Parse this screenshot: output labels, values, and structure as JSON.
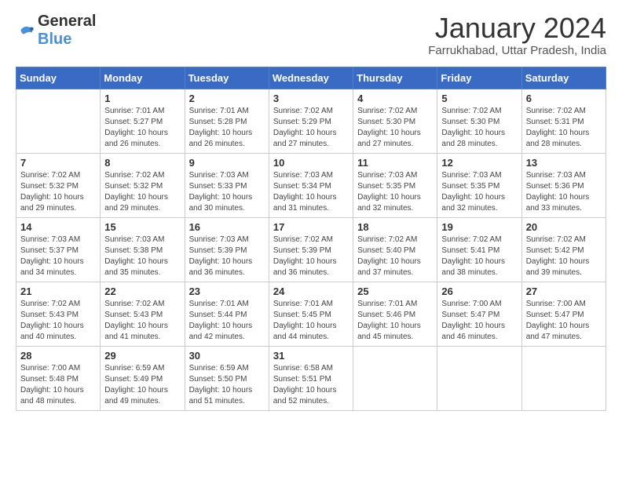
{
  "header": {
    "logo_line1": "General",
    "logo_line2": "Blue",
    "month": "January 2024",
    "location": "Farrukhabad, Uttar Pradesh, India"
  },
  "days_of_week": [
    "Sunday",
    "Monday",
    "Tuesday",
    "Wednesday",
    "Thursday",
    "Friday",
    "Saturday"
  ],
  "weeks": [
    [
      {
        "num": "",
        "info": ""
      },
      {
        "num": "1",
        "info": "Sunrise: 7:01 AM\nSunset: 5:27 PM\nDaylight: 10 hours\nand 26 minutes."
      },
      {
        "num": "2",
        "info": "Sunrise: 7:01 AM\nSunset: 5:28 PM\nDaylight: 10 hours\nand 26 minutes."
      },
      {
        "num": "3",
        "info": "Sunrise: 7:02 AM\nSunset: 5:29 PM\nDaylight: 10 hours\nand 27 minutes."
      },
      {
        "num": "4",
        "info": "Sunrise: 7:02 AM\nSunset: 5:30 PM\nDaylight: 10 hours\nand 27 minutes."
      },
      {
        "num": "5",
        "info": "Sunrise: 7:02 AM\nSunset: 5:30 PM\nDaylight: 10 hours\nand 28 minutes."
      },
      {
        "num": "6",
        "info": "Sunrise: 7:02 AM\nSunset: 5:31 PM\nDaylight: 10 hours\nand 28 minutes."
      }
    ],
    [
      {
        "num": "7",
        "info": "Sunrise: 7:02 AM\nSunset: 5:32 PM\nDaylight: 10 hours\nand 29 minutes."
      },
      {
        "num": "8",
        "info": "Sunrise: 7:02 AM\nSunset: 5:32 PM\nDaylight: 10 hours\nand 29 minutes."
      },
      {
        "num": "9",
        "info": "Sunrise: 7:03 AM\nSunset: 5:33 PM\nDaylight: 10 hours\nand 30 minutes."
      },
      {
        "num": "10",
        "info": "Sunrise: 7:03 AM\nSunset: 5:34 PM\nDaylight: 10 hours\nand 31 minutes."
      },
      {
        "num": "11",
        "info": "Sunrise: 7:03 AM\nSunset: 5:35 PM\nDaylight: 10 hours\nand 32 minutes."
      },
      {
        "num": "12",
        "info": "Sunrise: 7:03 AM\nSunset: 5:35 PM\nDaylight: 10 hours\nand 32 minutes."
      },
      {
        "num": "13",
        "info": "Sunrise: 7:03 AM\nSunset: 5:36 PM\nDaylight: 10 hours\nand 33 minutes."
      }
    ],
    [
      {
        "num": "14",
        "info": "Sunrise: 7:03 AM\nSunset: 5:37 PM\nDaylight: 10 hours\nand 34 minutes."
      },
      {
        "num": "15",
        "info": "Sunrise: 7:03 AM\nSunset: 5:38 PM\nDaylight: 10 hours\nand 35 minutes."
      },
      {
        "num": "16",
        "info": "Sunrise: 7:03 AM\nSunset: 5:39 PM\nDaylight: 10 hours\nand 36 minutes."
      },
      {
        "num": "17",
        "info": "Sunrise: 7:02 AM\nSunset: 5:39 PM\nDaylight: 10 hours\nand 36 minutes."
      },
      {
        "num": "18",
        "info": "Sunrise: 7:02 AM\nSunset: 5:40 PM\nDaylight: 10 hours\nand 37 minutes."
      },
      {
        "num": "19",
        "info": "Sunrise: 7:02 AM\nSunset: 5:41 PM\nDaylight: 10 hours\nand 38 minutes."
      },
      {
        "num": "20",
        "info": "Sunrise: 7:02 AM\nSunset: 5:42 PM\nDaylight: 10 hours\nand 39 minutes."
      }
    ],
    [
      {
        "num": "21",
        "info": "Sunrise: 7:02 AM\nSunset: 5:43 PM\nDaylight: 10 hours\nand 40 minutes."
      },
      {
        "num": "22",
        "info": "Sunrise: 7:02 AM\nSunset: 5:43 PM\nDaylight: 10 hours\nand 41 minutes."
      },
      {
        "num": "23",
        "info": "Sunrise: 7:01 AM\nSunset: 5:44 PM\nDaylight: 10 hours\nand 42 minutes."
      },
      {
        "num": "24",
        "info": "Sunrise: 7:01 AM\nSunset: 5:45 PM\nDaylight: 10 hours\nand 44 minutes."
      },
      {
        "num": "25",
        "info": "Sunrise: 7:01 AM\nSunset: 5:46 PM\nDaylight: 10 hours\nand 45 minutes."
      },
      {
        "num": "26",
        "info": "Sunrise: 7:00 AM\nSunset: 5:47 PM\nDaylight: 10 hours\nand 46 minutes."
      },
      {
        "num": "27",
        "info": "Sunrise: 7:00 AM\nSunset: 5:47 PM\nDaylight: 10 hours\nand 47 minutes."
      }
    ],
    [
      {
        "num": "28",
        "info": "Sunrise: 7:00 AM\nSunset: 5:48 PM\nDaylight: 10 hours\nand 48 minutes."
      },
      {
        "num": "29",
        "info": "Sunrise: 6:59 AM\nSunset: 5:49 PM\nDaylight: 10 hours\nand 49 minutes."
      },
      {
        "num": "30",
        "info": "Sunrise: 6:59 AM\nSunset: 5:50 PM\nDaylight: 10 hours\nand 51 minutes."
      },
      {
        "num": "31",
        "info": "Sunrise: 6:58 AM\nSunset: 5:51 PM\nDaylight: 10 hours\nand 52 minutes."
      },
      {
        "num": "",
        "info": ""
      },
      {
        "num": "",
        "info": ""
      },
      {
        "num": "",
        "info": ""
      }
    ]
  ]
}
